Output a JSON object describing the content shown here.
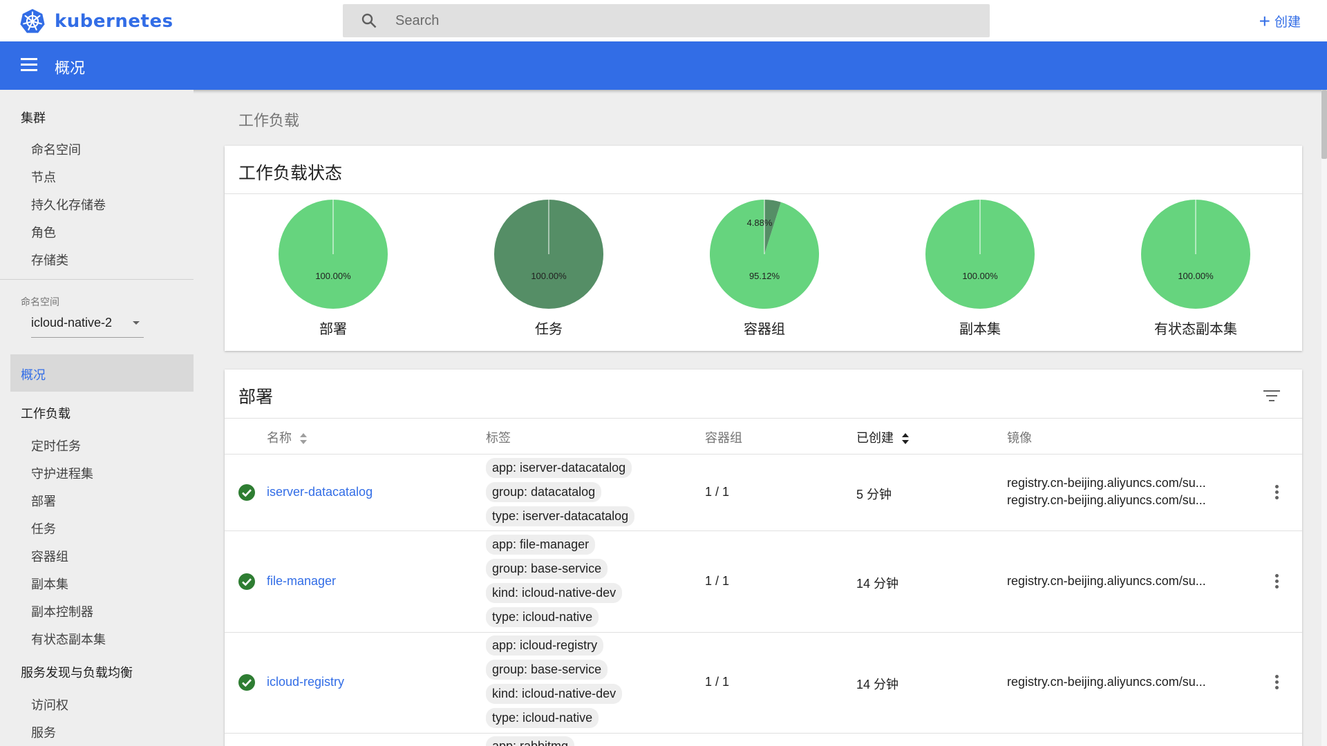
{
  "header": {
    "app_name": "kubernetes",
    "search_placeholder": "Search",
    "create_label": "创建"
  },
  "titlebar": {
    "title": "概况"
  },
  "sidebar": {
    "cluster_heading": "集群",
    "cluster_items": [
      "命名空间",
      "节点",
      "持久化存储卷",
      "角色",
      "存储类"
    ],
    "namespace_label": "命名空间",
    "namespace_value": "icloud-native-2",
    "overview": "概况",
    "workloads_heading": "工作负载",
    "workload_items": [
      "定时任务",
      "守护进程集",
      "部署",
      "任务",
      "容器组",
      "副本集",
      "副本控制器",
      "有状态副本集"
    ],
    "discovery_heading": "服务发现与负载均衡",
    "discovery_items": [
      "访问权",
      "服务"
    ]
  },
  "main": {
    "section_title": "工作负载",
    "status_card_title": "工作负载状态",
    "deployments_card_title": "部署"
  },
  "chart_data": {
    "type": "pie",
    "charts": [
      {
        "label": "部署",
        "slices": [
          {
            "value": 100.0,
            "text": "100.00%",
            "color": "#66d47e"
          }
        ]
      },
      {
        "label": "任务",
        "slices": [
          {
            "value": 100.0,
            "text": "100.00%",
            "color": "#558e66"
          }
        ]
      },
      {
        "label": "容器组",
        "slices": [
          {
            "value": 95.12,
            "text": "95.12%",
            "color": "#66d47e"
          },
          {
            "value": 4.88,
            "text": "4.88%",
            "color": "#558e66"
          }
        ]
      },
      {
        "label": "副本集",
        "slices": [
          {
            "value": 100.0,
            "text": "100.00%",
            "color": "#66d47e"
          }
        ]
      },
      {
        "label": "有状态副本集",
        "slices": [
          {
            "value": 100.0,
            "text": "100.00%",
            "color": "#66d47e"
          }
        ]
      }
    ]
  },
  "table": {
    "headers": {
      "name": "名称",
      "labels": "标签",
      "pods": "容器组",
      "created": "已创建",
      "images": "镜像"
    },
    "rows": [
      {
        "name": "iserver-datacatalog",
        "labels": [
          "app: iserver-datacatalog",
          "group: datacatalog",
          "type: iserver-datacatalog"
        ],
        "pods": "1 / 1",
        "created": "5 分钟",
        "images": [
          "registry.cn-beijing.aliyuncs.com/su...",
          "registry.cn-beijing.aliyuncs.com/su..."
        ]
      },
      {
        "name": "file-manager",
        "labels": [
          "app: file-manager",
          "group: base-service",
          "kind: icloud-native-dev",
          "type: icloud-native"
        ],
        "pods": "1 / 1",
        "created": "14 分钟",
        "images": [
          "registry.cn-beijing.aliyuncs.com/su..."
        ]
      },
      {
        "name": "icloud-registry",
        "labels": [
          "app: icloud-registry",
          "group: base-service",
          "kind: icloud-native-dev",
          "type: icloud-native"
        ],
        "pods": "1 / 1",
        "created": "14 分钟",
        "images": [
          "registry.cn-beijing.aliyuncs.com/su..."
        ]
      },
      {
        "labels": [
          "app: rabbitmq"
        ]
      }
    ]
  },
  "colors": {
    "brand": "#326de6",
    "ok": "#2e7d32",
    "pie_primary": "#66d47e",
    "pie_secondary": "#558e66"
  }
}
